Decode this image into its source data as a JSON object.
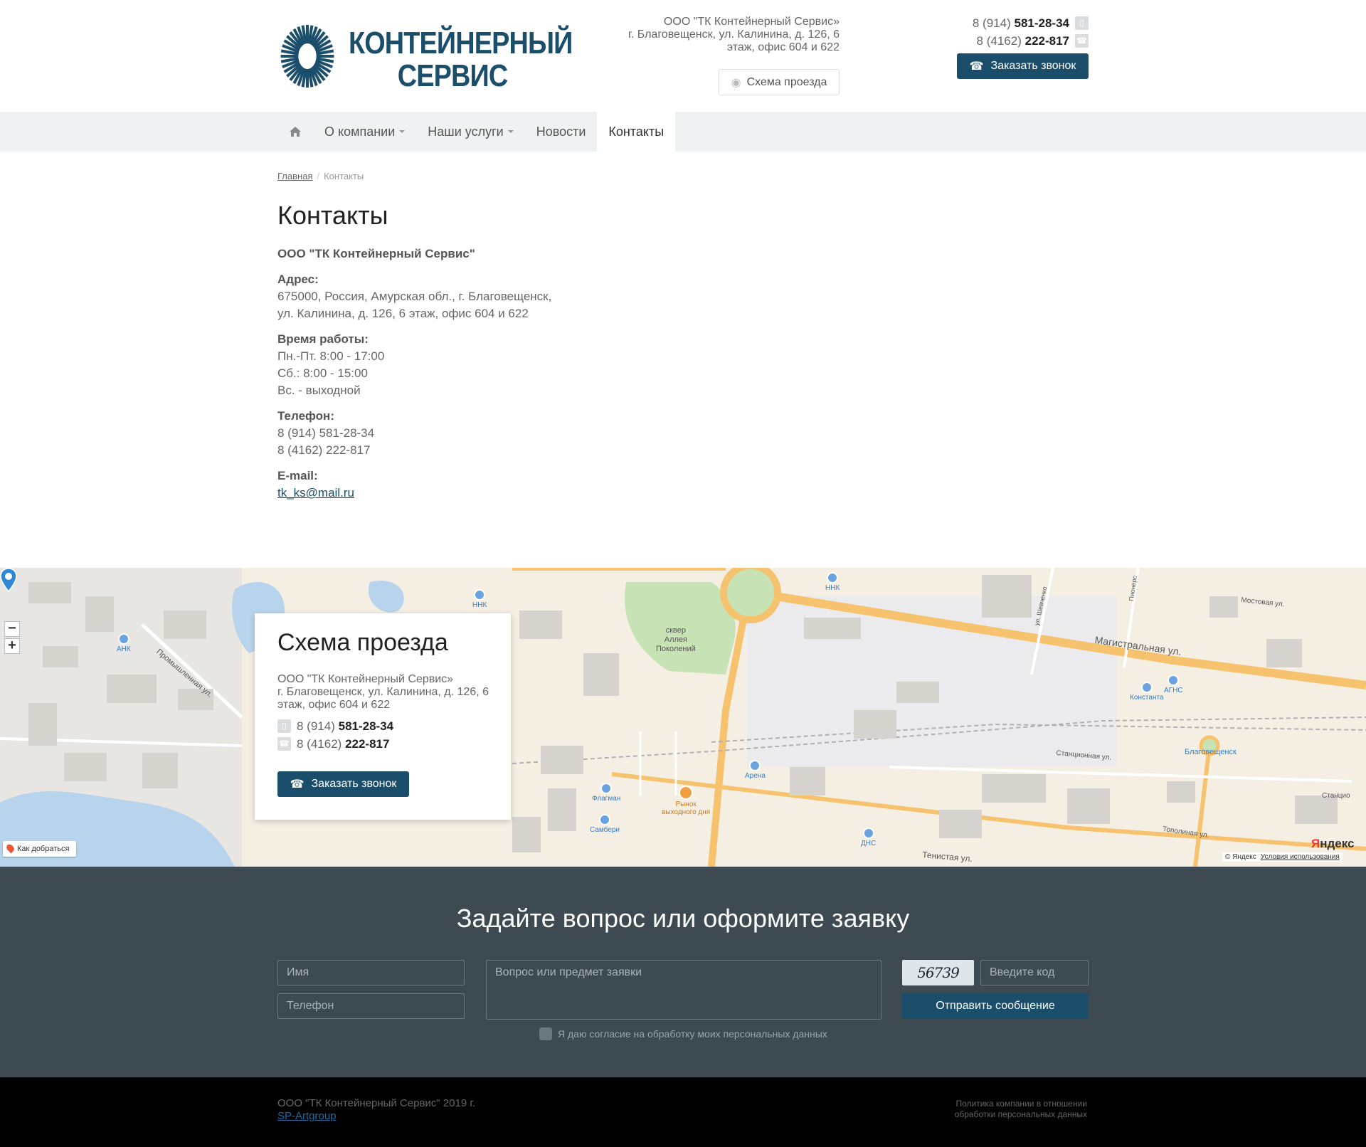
{
  "header": {
    "logo": {
      "line1": "КОНТЕЙНЕРНЫЙ",
      "line2": "СЕРВИС"
    },
    "address_lines": [
      "ООО \"ТК Контейнерный Сервис»",
      "г. Благовещенск, ул. Калинина, д. 126, 6",
      "этаж, офис 604 и 622"
    ],
    "map_link_label": "Схема проезда",
    "phones": [
      {
        "prefix": "8 (914)",
        "number": "581-28-34",
        "icon": "mobile-icon"
      },
      {
        "prefix": "8 (4162)",
        "number": "222-817",
        "icon": "phone-icon"
      }
    ],
    "call_button_label": "Заказать звонок"
  },
  "nav": {
    "home_icon": "home-icon",
    "items": [
      {
        "label": "О компании",
        "dropdown": true
      },
      {
        "label": "Наши услуги",
        "dropdown": true
      },
      {
        "label": "Новости",
        "dropdown": false
      },
      {
        "label": "Контакты",
        "dropdown": false,
        "active": true
      }
    ]
  },
  "breadcrumb": {
    "home": "Главная",
    "current": "Контакты"
  },
  "page_title": "Контакты",
  "contacts": {
    "company": "ООО \"ТК Контейнерный Сервис\"",
    "address_label": "Адрес:",
    "address_lines": [
      "675000, Россия, Амурская обл., г. Благовещенск,",
      "ул. Калинина, д. 126, 6 этаж, офис 604 и 622"
    ],
    "hours_label": "Время работы:",
    "hours_lines": [
      "Пн.-Пт. 8:00 - 17:00",
      "Сб.: 8:00 - 15:00",
      "Вс. - выходной"
    ],
    "phone_label": "Телефон:",
    "phone_lines": [
      "8 (914) 581-28-34",
      "8 (4162) 222-817"
    ],
    "email_label": "E-mail:",
    "email": "tk_ks@mail.ru"
  },
  "map": {
    "card": {
      "title": "Схема проезда",
      "address_lines": [
        "ООО \"ТК Контейнерный Сервис»",
        "г. Благовещенск, ул. Калинина, д. 126, 6",
        "этаж, офис 604 и 622"
      ],
      "phones": [
        {
          "prefix": "8 (914)",
          "number": "581-28-34"
        },
        {
          "prefix": "8 (4162)",
          "number": "222-817"
        }
      ],
      "call_button_label": "Заказать звонок"
    },
    "zoom_out": "−",
    "zoom_in": "+",
    "route_link": "Как добраться",
    "labels": {
      "promyshlennaya": "Промышленная ул.",
      "magistralnaya": "Магистральная ул.",
      "mostovaya": "Мостовая ул.",
      "stantsionnaya": "Станционная ул.",
      "topolinaya": "Тополиная ул.",
      "tenistaya": "Тенистая ул.",
      "shevchenko": "ул. Шевченко",
      "pionerskaya": "Пионерс",
      "stantsio2": "Станцио",
      "park": "сквер\nАллея\nПоколений",
      "blagoveshchensk": "Благовещенск"
    },
    "pois": {
      "ank": "АНК",
      "nnk1": "ННК",
      "nnk2": "ННК",
      "konstanta": "Константа",
      "ags": "АГНС",
      "arena": "Арена",
      "flagman": "Флагман",
      "samberi": "Самбери",
      "dns": "ДНС",
      "rynok": "Рынок\nвыходного дня"
    },
    "yandex_logo": {
      "a": "Я",
      "b": "ндекс"
    },
    "copyright": "© Яндекс",
    "terms": "Условия использования"
  },
  "form": {
    "title": "Задайте вопрос или оформите заявку",
    "name_placeholder": "Имя",
    "phone_placeholder": "Телефон",
    "message_placeholder": "Вопрос или предмет заявки",
    "captcha_text": "56739",
    "code_placeholder": "Введите код",
    "submit_label": "Отправить сообщение",
    "consent_label": "Я даю согласие на обработку моих персональных данных"
  },
  "footer": {
    "copyright": "ООО \"ТК Контейнерный Сервис\" 2019 г.",
    "developer": "SP-Artgroup",
    "policy_lines": [
      "Политика компании в отношении",
      "обработки персональных данных"
    ]
  },
  "colors": {
    "brand": "#1b4e6b",
    "nav_bg": "#eef2f3",
    "form_bg": "#3d4a51",
    "footer_bg": "#000000"
  }
}
